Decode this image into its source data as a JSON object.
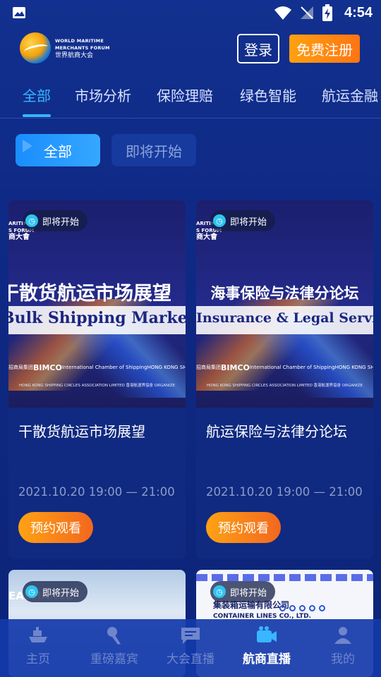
{
  "status_bar": {
    "time": "4:54",
    "icons": [
      "image-icon",
      "wifi-icon",
      "signal-off-icon",
      "battery-charging-icon"
    ]
  },
  "header": {
    "logo": {
      "en_line1": "WORLD MARITIME",
      "en_line2": "MERCHANTS FORUM",
      "cn": "世界航商大会"
    },
    "login_label": "登录",
    "register_label": "免费注册"
  },
  "category_tabs": [
    {
      "label": "全部",
      "active": true
    },
    {
      "label": "市场分析",
      "active": false
    },
    {
      "label": "保险理赔",
      "active": false
    },
    {
      "label": "绿色智能",
      "active": false
    },
    {
      "label": "航运金融",
      "active": false
    }
  ],
  "filters": {
    "all_label": "全部",
    "upcoming_label": "即将开始"
  },
  "cards": [
    {
      "badge": "即将开始",
      "banner_cn": "干散货航运市场展望",
      "banner_en": "Bulk Shipping Market Outlook",
      "forum_en1": "ARITIME",
      "forum_en2": "S FORUM",
      "forum_cn": "商大會",
      "sponsors": [
        "招商局集团",
        "BIMCO",
        "International Chamber of Shipping",
        "HONG KONG SHIPOWNERS"
      ],
      "sponsors2": "HONG KONG SHIPPING CIRCLES ASSOCIATION LIMITED  香港航運界協會  ORGANIZE",
      "title": "干散货航运市场展望",
      "time": "2021.10.20 19:00 — 21:00",
      "button": "预约观看"
    },
    {
      "badge": "即将开始",
      "banner_cn": "海事保险与法律分论坛",
      "banner_en": "Insurance & Legal Service",
      "forum_en1": "ARITIME",
      "forum_en2": "S FORUM",
      "forum_cn": "商大會",
      "sponsors": [
        "招商局集团",
        "BIMCO",
        "International Chamber of Shipping",
        "HONG KONG SHIPOWNERS"
      ],
      "sponsors2": "HONG KONG SHIPPING CIRCLES ASSOCIATION LIMITED  香港航運界協會  ORGANIZE",
      "title": "航运保险与法律分论坛",
      "time": "2021.10.20 19:00 — 21:00",
      "button": "预约观看"
    }
  ],
  "cards_partial": [
    {
      "badge": "即将开始",
      "text": "EALLIANCE"
    },
    {
      "badge": "即将开始",
      "company_cn": "集装箱运输有限公司",
      "company_en": "CONTAINER LINES CO., LTD."
    }
  ],
  "bottom_nav": [
    {
      "label": "主页",
      "icon": "ship-icon",
      "active": false
    },
    {
      "label": "重磅嘉宾",
      "icon": "microphone-icon",
      "active": false
    },
    {
      "label": "大会直播",
      "icon": "chat-icon",
      "active": false
    },
    {
      "label": "航商直播",
      "icon": "video-camera-icon",
      "active": true
    },
    {
      "label": "我的",
      "icon": "user-icon",
      "active": false
    }
  ],
  "colors": {
    "background": "#12308f",
    "accent_blue": "#38b6ff",
    "accent_orange": "#ff8a14",
    "nav_active": "#ffffff",
    "nav_inactive": "#6f86cc"
  }
}
